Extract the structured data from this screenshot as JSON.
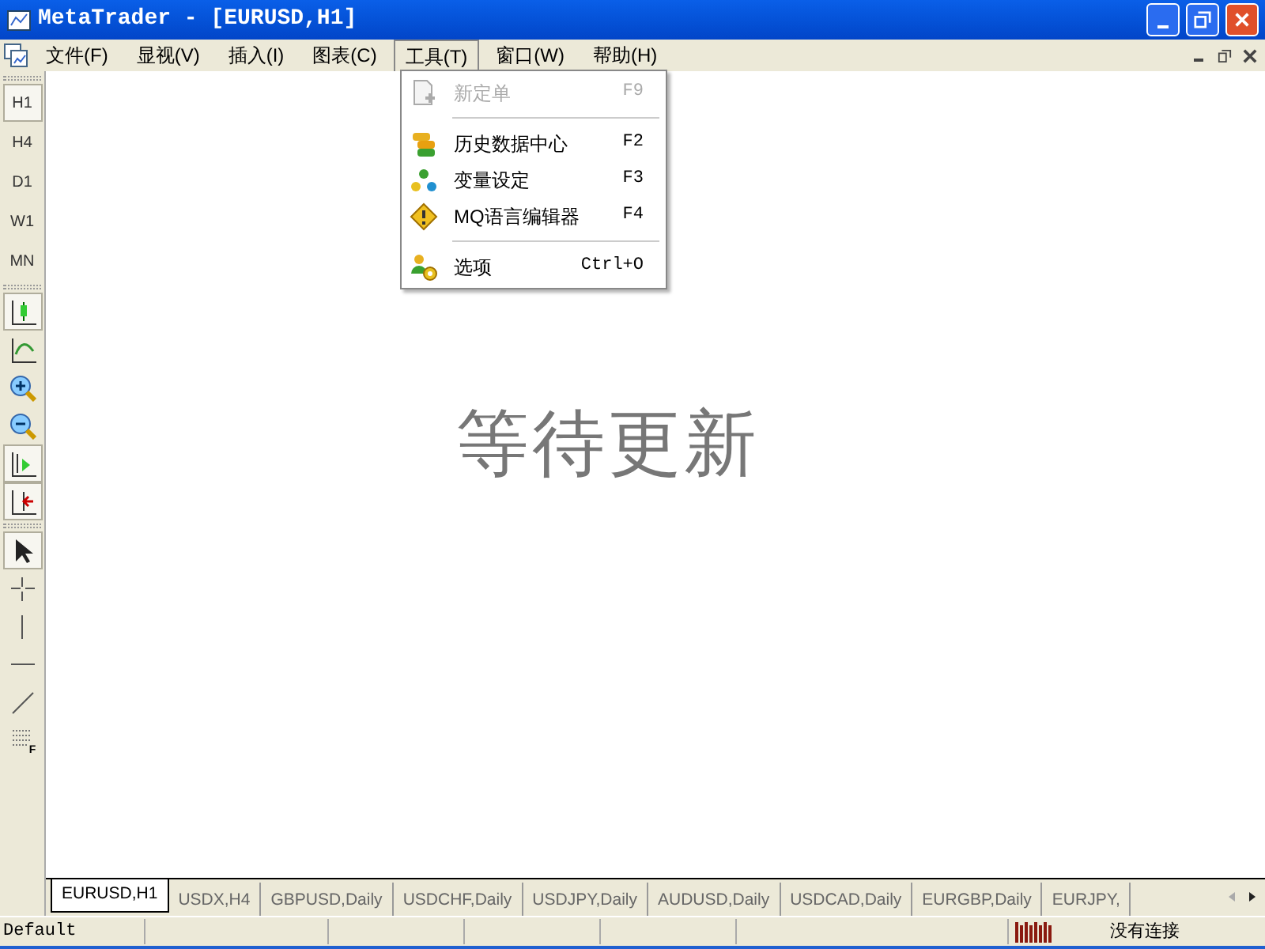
{
  "window": {
    "title": "MetaTrader - [EURUSD,H1]"
  },
  "menu_bar": [
    {
      "label": "文件(F)",
      "selected": false
    },
    {
      "label": "显视(V)",
      "selected": false
    },
    {
      "label": "插入(I)",
      "selected": false
    },
    {
      "label": "图表(C)",
      "selected": false
    },
    {
      "label": "工具(T)",
      "selected": true
    },
    {
      "label": "窗口(W)",
      "selected": false
    },
    {
      "label": "帮助(H)",
      "selected": false
    }
  ],
  "tools_menu": [
    {
      "kind": "new-order",
      "label": "新定单",
      "shortcut": "F9",
      "disabled": true
    },
    {
      "kind": "separator"
    },
    {
      "kind": "history",
      "label": "历史数据中心",
      "shortcut": "F2",
      "disabled": false
    },
    {
      "kind": "variables",
      "label": "变量设定",
      "shortcut": "F3",
      "disabled": false
    },
    {
      "kind": "editor",
      "label": "MQ语言编辑器",
      "shortcut": "F4",
      "disabled": false
    },
    {
      "kind": "separator"
    },
    {
      "kind": "options",
      "label": "选项",
      "shortcut": "Ctrl+O",
      "disabled": false
    }
  ],
  "timeframes": [
    {
      "label": "H1",
      "selected": true
    },
    {
      "label": "H4",
      "selected": false
    },
    {
      "label": "D1",
      "selected": false
    },
    {
      "label": "W1",
      "selected": false
    },
    {
      "label": "MN",
      "selected": false
    }
  ],
  "chart_tools": [
    {
      "kind": "candles",
      "pressed": true
    },
    {
      "kind": "line",
      "pressed": false
    },
    {
      "kind": "zoom-in",
      "pressed": false
    },
    {
      "kind": "zoom-out",
      "pressed": false
    },
    {
      "kind": "shift",
      "pressed": true
    },
    {
      "kind": "autoscroll",
      "pressed": true
    }
  ],
  "draw_tools": [
    {
      "kind": "cursor",
      "pressed": true
    },
    {
      "kind": "crosshair",
      "pressed": false
    },
    {
      "kind": "vline",
      "pressed": false
    },
    {
      "kind": "hline",
      "pressed": false
    },
    {
      "kind": "trend",
      "pressed": false
    },
    {
      "kind": "fibo",
      "pressed": false,
      "label": "F"
    }
  ],
  "chart": {
    "message": "等待更新"
  },
  "chart_tabs": [
    {
      "label": "EURUSD,H1",
      "selected": true
    },
    {
      "label": "USDX,H4",
      "selected": false
    },
    {
      "label": "GBPUSD,Daily",
      "selected": false
    },
    {
      "label": "USDCHF,Daily",
      "selected": false
    },
    {
      "label": "USDJPY,Daily",
      "selected": false
    },
    {
      "label": "AUDUSD,Daily",
      "selected": false
    },
    {
      "label": "USDCAD,Daily",
      "selected": false
    },
    {
      "label": "EURGBP,Daily",
      "selected": false
    },
    {
      "label": "EURJPY,",
      "selected": false
    }
  ],
  "status_bar": {
    "profile": "Default",
    "connection": "没有连接"
  }
}
